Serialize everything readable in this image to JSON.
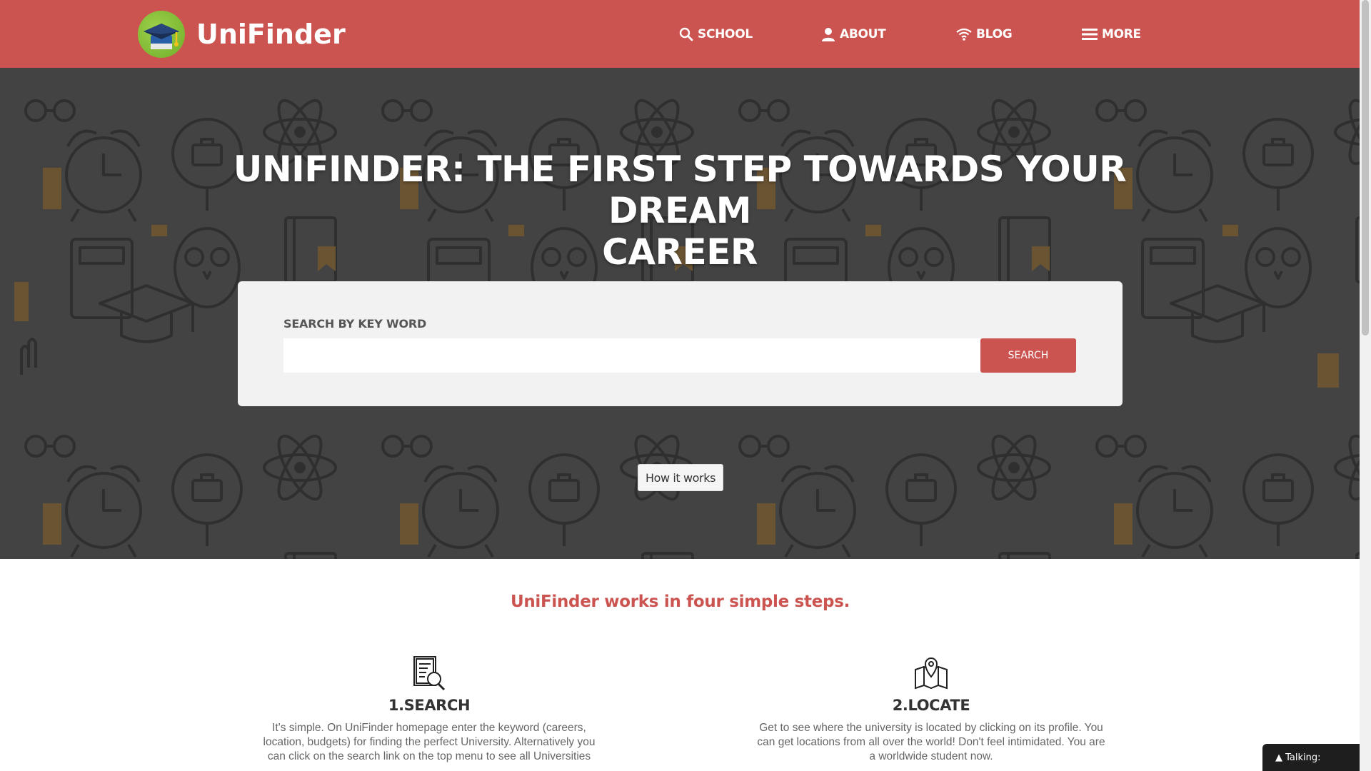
{
  "brand": {
    "name": "UniFinder",
    "logo_icon": "graduation-cap-icon"
  },
  "nav": [
    {
      "label": "SCHOOL",
      "icon": "search-icon"
    },
    {
      "label": "ABOUT",
      "icon": "user-icon"
    },
    {
      "label": "BLOG",
      "icon": "wifi-icon"
    },
    {
      "label": "MORE",
      "icon": "menu-icon"
    }
  ],
  "hero": {
    "title_line1": "UNIFINDER: THE FIRST STEP TOWARDS YOUR DREAM",
    "title_line2": "CAREER",
    "search_label": "SEARCH BY KEY WORD",
    "search_value": "",
    "search_button": "SEARCH",
    "how_button": "How it works"
  },
  "steps": {
    "heading": "UniFinder works in four simple steps.",
    "items": [
      {
        "title": "1.SEARCH",
        "icon": "document-search-icon",
        "text_lines": [
          "It's simple. On UniFinder homepage enter the keyword (careers,",
          "location, budgets) for finding the perfect University. Alternatively you",
          "can click on the search link on the top menu to see all Universities"
        ]
      },
      {
        "title": "2.LOCATE",
        "icon": "map-pin-icon",
        "text_lines": [
          "Get to see where the university is located by clicking on its profile. You",
          "can get locations from all over the world! Don't feel intimidated. You are",
          "a worldwide student now."
        ]
      }
    ]
  },
  "chat": {
    "label": "▲ Talking:"
  },
  "colors": {
    "brand_red": "#cc5450",
    "hero_bg": "#434343",
    "accent_brown": "#6b5432"
  }
}
